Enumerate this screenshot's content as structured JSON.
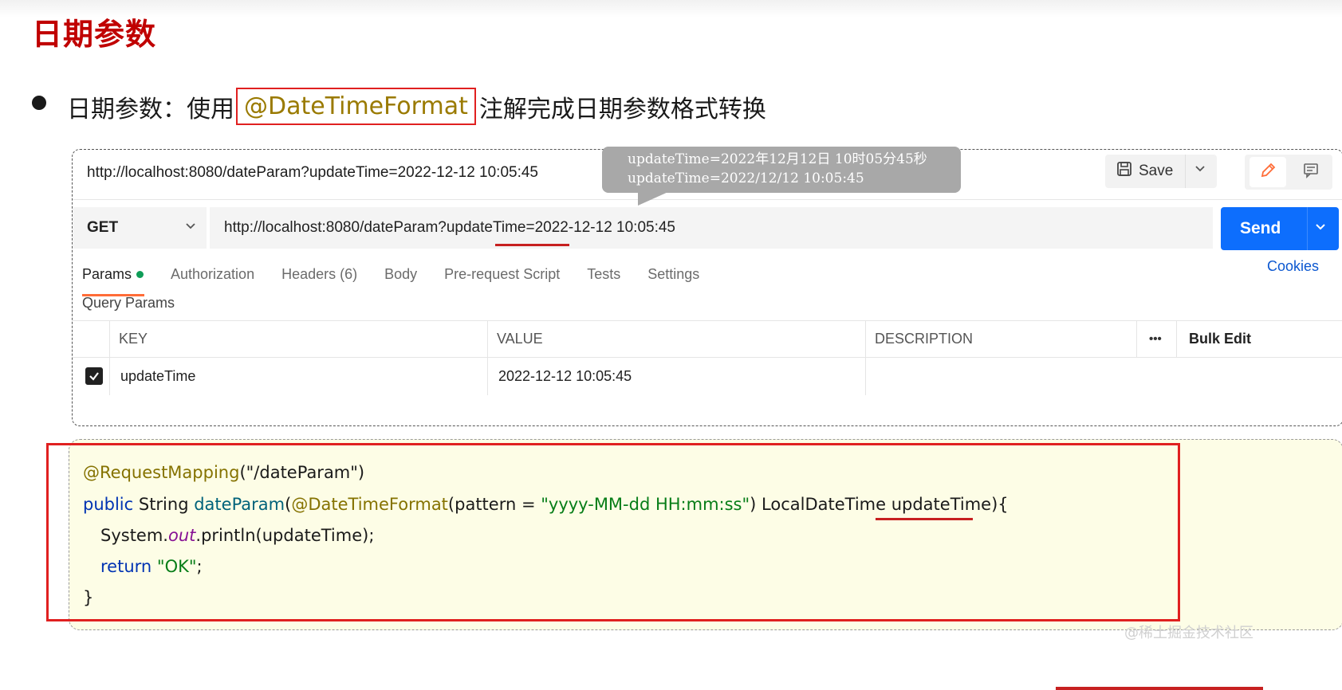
{
  "slide": {
    "title": "日期参数",
    "bullet_prefix": "日期参数：使用",
    "bullet_highlight": "@DateTimeFormat",
    "bullet_suffix": "注解完成日期参数格式转换"
  },
  "postman": {
    "request_name": "http://localhost:8080/dateParam?updateTime=2022-12-12 10:05:45",
    "save_label": "Save",
    "method": "GET",
    "url_value": "http://localhost:8080/dateParam?updateTime=2022-12-12 10:05:45",
    "send_label": "Send",
    "tabs": [
      {
        "label": "Params"
      },
      {
        "label": "Authorization"
      },
      {
        "label": "Headers (6)"
      },
      {
        "label": "Body"
      },
      {
        "label": "Pre-request Script"
      },
      {
        "label": "Tests"
      },
      {
        "label": "Settings"
      }
    ],
    "cookies_label": "Cookies",
    "query_params_label": "Query Params",
    "table": {
      "headers": {
        "key": "KEY",
        "value": "VALUE",
        "description": "DESCRIPTION",
        "more": "•••",
        "bulk_edit": "Bulk Edit"
      },
      "rows": [
        {
          "checked": true,
          "key": "updateTime",
          "value": "2022-12-12 10:05:45",
          "description": ""
        }
      ]
    }
  },
  "tooltip": {
    "line1": "updateTime=2022年12月12日 10时05分45秒",
    "line2": "updateTime=2022/12/12 10:05:45"
  },
  "code": {
    "line1_ann": "@RequestMapping",
    "line1_rest": "(\"/dateParam\")",
    "line2_kw": "public",
    "line2_type": " String ",
    "line2_fn": "dateParam",
    "line2_p1": "(",
    "line2_ann": "@DateTimeFormat",
    "line2_p2": "(pattern = ",
    "line2_str": "\"yyyy-MM-dd HH:mm:ss\"",
    "line2_p3": ") LocalDateTime updateTime){",
    "line3_a": "System.",
    "line3_out": "out",
    "line3_b": ".println(updateTime);",
    "line4_kw": "return",
    "line4_str": "\"OK\"",
    "line4_end": ";",
    "line5": "}"
  },
  "watermark": "@稀土掘金技术社区",
  "colors": {
    "title_red": "#c00000",
    "annotation_red": "#e02020",
    "send_blue": "#0d6efd",
    "tab_active_orange": "#ff6c37",
    "code_bg": "#fdfde6"
  }
}
